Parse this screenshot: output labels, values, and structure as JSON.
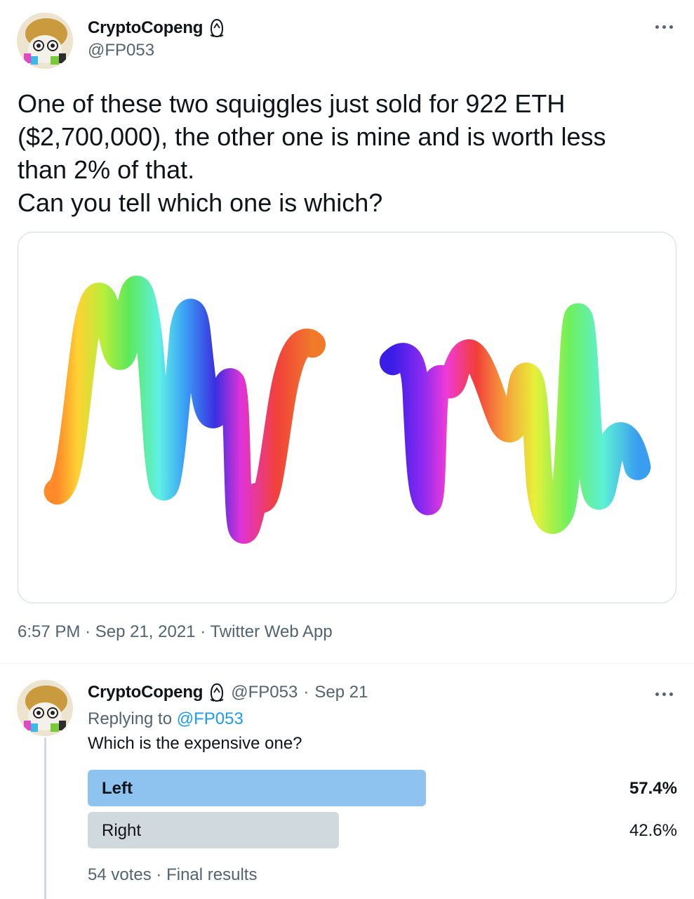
{
  "tweet": {
    "author": {
      "display_name": "CryptoCopeng",
      "handle": "@FP053",
      "badge_icon": "penguin-icon"
    },
    "text_lines": [
      "One of these two squiggles just sold for 922 ETH",
      "($2,700,000), the other one is mine and is worth less",
      "than 2% of that.",
      "Can you tell which one is which?"
    ],
    "media_alt": "two rainbow squiggles",
    "meta": {
      "time": "6:57 PM",
      "separator": "·",
      "date": "Sep 21, 2021",
      "source": "Twitter Web App"
    },
    "more_icon": "more-horizontal-icon"
  },
  "reply": {
    "author": {
      "display_name": "CryptoCopeng",
      "handle": "@FP053",
      "date": "Sep 21"
    },
    "separator": "·",
    "replying_to_prefix": "Replying to",
    "replying_to_handle": "@FP053",
    "text": "Which is the expensive one?",
    "poll": {
      "options": [
        {
          "label": "Left",
          "percent_text": "57.4%",
          "percent": 57.4,
          "winner": true,
          "color": "#8ec3f0"
        },
        {
          "label": "Right",
          "percent_text": "42.6%",
          "percent": 42.6,
          "winner": false,
          "color": "#cfd9de"
        }
      ],
      "votes": "54 votes",
      "status": "Final results"
    }
  },
  "colors": {
    "text": "#0f1419",
    "secondary": "#536471",
    "link": "#1d9bf0",
    "border": "#cfd9de"
  }
}
